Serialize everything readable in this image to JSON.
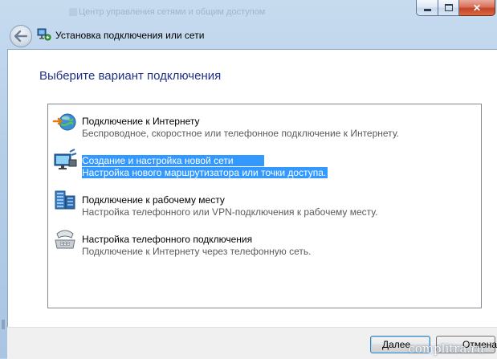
{
  "window": {
    "title": "Установка подключения или сети",
    "ghost_title": "Центр управления сетями и общим доступом",
    "instruction": "Выберите вариант подключения"
  },
  "options": [
    {
      "title": "Подключение к Интернету",
      "description": "Беспроводное, скоростное или телефонное подключение к Интернету.",
      "icon": "internet-connection-icon",
      "selected": false
    },
    {
      "title": "Создание и настройка новой сети",
      "description": "Настройка нового маршрутизатора или точки доступа.",
      "icon": "new-network-icon",
      "selected": true
    },
    {
      "title": "Подключение к рабочему месту",
      "description": "Настройка телефонного или VPN-подключения к рабочему месту.",
      "icon": "workplace-connection-icon",
      "selected": false
    },
    {
      "title": "Настройка телефонного подключения",
      "description": "Подключение к Интернету через телефонную сеть.",
      "icon": "dialup-phone-icon",
      "selected": false
    }
  ],
  "buttons": {
    "next": "Далее",
    "cancel": "Отмена"
  },
  "watermark": "complitra.ru",
  "colors": {
    "instruction": "#1e3287",
    "selection": "#3399ff",
    "frame": "#b6cfe8"
  }
}
